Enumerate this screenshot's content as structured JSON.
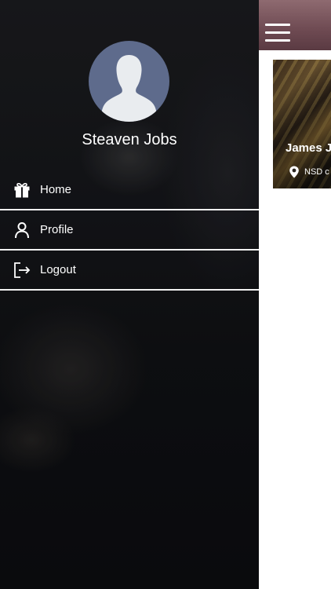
{
  "user": {
    "name": "Steaven Jobs"
  },
  "menu": {
    "items": [
      {
        "label": "Home",
        "icon": "gift-icon"
      },
      {
        "label": "Profile",
        "icon": "person-icon"
      },
      {
        "label": "Logout",
        "icon": "logout-icon"
      }
    ]
  },
  "main": {
    "card": {
      "title": "James J",
      "location": "NSD c"
    }
  },
  "colors": {
    "avatar_bg": "#5e6b8c",
    "topbar": "#7a555d",
    "drawer_bg": "#131417"
  }
}
